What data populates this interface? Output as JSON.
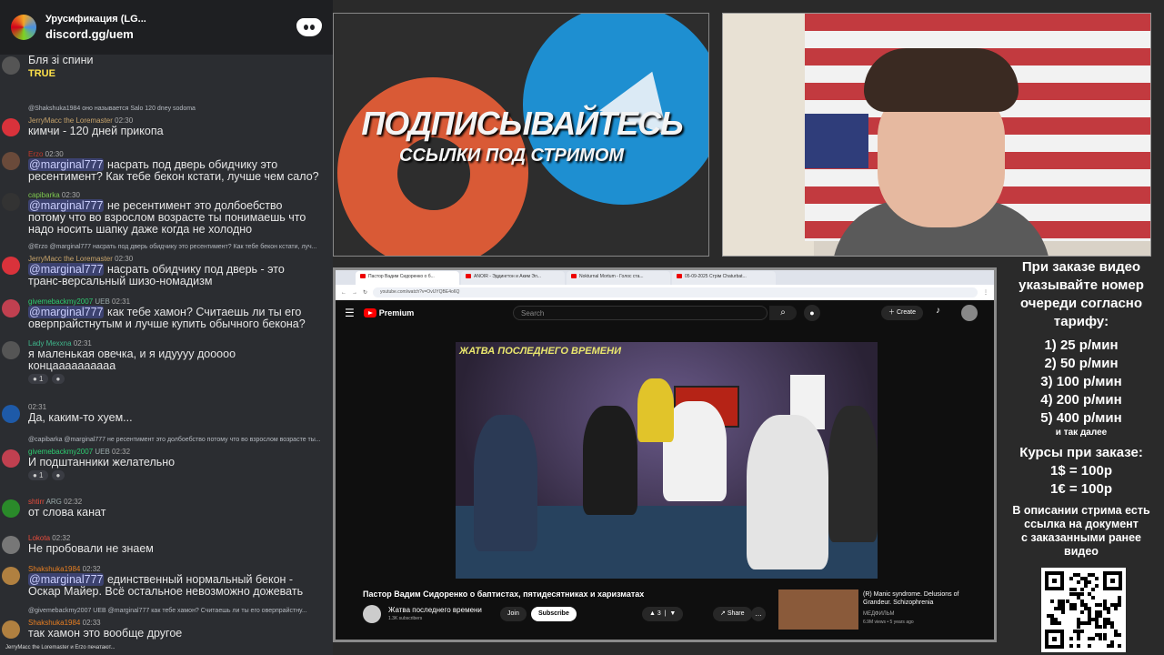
{
  "discord": {
    "server_name": "Урусификация (LG...",
    "invite": "discord.gg/uem"
  },
  "chat": [
    {
      "user": "",
      "text": "Бля зі спини",
      "emote": "TRUE"
    },
    {
      "reply": "@Shakshuka1984 оно называется Salo 120 dney sodoma",
      "user": "JerryMacc the Loremaster",
      "time": "02:30",
      "text": "кимчи - 120 дней прикопа"
    },
    {
      "user": "Erzo",
      "time": "02:30",
      "mention": "@marginal777",
      "text": " насрать под дверь обидчику это\nресентимент? Как тебе бекон кстати, лучше чем сало?"
    },
    {
      "user": "capibarka",
      "time": "02:30",
      "mention": "@marginal777",
      "text": " не ресентимент это долбоебство\nпотому что во взрослом возрасте ты понимаешь что\nнадо носить шапку даже когда не холодно"
    },
    {
      "reply": "@Erzo @marginal777 насрать под дверь обидчику это ресентимент? Как тебе бекон кстати, луч...",
      "user": "JerryMacc the Loremaster",
      "time": "02:30",
      "mention": "@marginal777",
      "text": " насрать обидчику под дверь - это\nтранс-версальный шизо-номадизм"
    },
    {
      "user": "givemebackmy2007",
      "badge": "UEB",
      "time": "02:31",
      "mention": "@marginal777",
      "text": " как тебе хамон? Считаешь ли ты его\nоверпрайстнутым и лучше купить обычного бекона?"
    },
    {
      "user": "Lady Mexxna",
      "time": "02:31",
      "text": "я маленькая овечка, и я идуууу доoooo\nконцаааааааааа",
      "reactions": [
        "1",
        ""
      ]
    },
    {
      "user": "",
      "time": "02:31",
      "text": "Да, каким-то хуем..."
    },
    {
      "reply": "@capibarka @marginal777 не ресентимент это долбоебство потому что во взрослом возрасте ты...",
      "user": "givemebackmy2007",
      "badge": "UEB",
      "time": "02:32",
      "text": "И подштанники желательно",
      "reactions": [
        "1",
        ""
      ]
    },
    {
      "user": "shtirr",
      "badge": "ARG",
      "time": "02:32",
      "text": "от слова канат"
    },
    {
      "user": "Lokota",
      "time": "02:32",
      "text": "Не пробовали не знаем"
    },
    {
      "user": "Shakshuka1984",
      "time": "02:32",
      "mention": "@marginal777",
      "text": " единственный нормальный бекон -\nОскар Майер. Всё остальное невозможно дожевать"
    },
    {
      "reply": "@givemebackmy2007 UEB @marginal777 как тебе хамон? Считаешь ли ты его оверпрайстну...",
      "user": "Shakshuka1984",
      "time": "02:33",
      "text": "так хамон это вообще другое"
    }
  ],
  "typing": "JerryMacc the Loremaster и Erzo печатают...",
  "promo": {
    "title": "ПОДПИСЫВАЙТЕСЬ",
    "subtitle": "ССЫЛКИ ПОД СТРИМОМ"
  },
  "browser": {
    "tabs": [
      "Пастор Вадим Сидоренко о б...",
      "ANOIR - Эддингтон и Аким Эл...",
      "Nokturnal Mortum - Голос ста...",
      "05-09-2025 Стрім Chaturbat..."
    ],
    "url": "youtube.com/watch?v=OvUYQBE4o6Q"
  },
  "youtube": {
    "logo": "Premium",
    "search_placeholder": "Search",
    "create": "Create",
    "video_overlay_title": "ЖАТВА ПОСЛЕДНЕГО ВРЕМЕНИ",
    "video_title": "Пастор Вадим Сидоренко о баптистах, пятидесятниках и харизматах",
    "channel": "Жатва последнего времени",
    "subscribers": "1.3K subscribers",
    "join": "Join",
    "subscribe": "Subscribe",
    "likes": "3",
    "share": "Share",
    "rec_title": "(R) Manic syndrome. Delusions of Grandeur. Schizophrenia",
    "rec_channel": "МЕДФИЛЬМ",
    "rec_meta": "6.9M views • 5 years ago"
  },
  "info": {
    "order_lines": [
      "При заказе видео",
      "указывайте номер",
      "очереди согласно",
      "тарифу:"
    ],
    "tariffs": [
      "1) 25 р/мин",
      "2) 50 р/мин",
      "3) 100 р/мин",
      "4) 200 р/мин",
      "5) 400 р/мин"
    ],
    "etc": "и так далее",
    "rates_title": "Курсы при заказе:",
    "rates": [
      "1$ = 100р",
      "1€ = 100р"
    ],
    "desc_lines": [
      "В описании стрима есть",
      "ссылка на документ",
      "с заказанными ранее",
      "видео"
    ]
  },
  "colors": {
    "discord_bg": "#2b2d31",
    "mention_bg": "#3c4270",
    "yt_red": "#ff0000",
    "telegram_blue": "#1e8fd1",
    "patreon_orange": "#d95a36"
  }
}
